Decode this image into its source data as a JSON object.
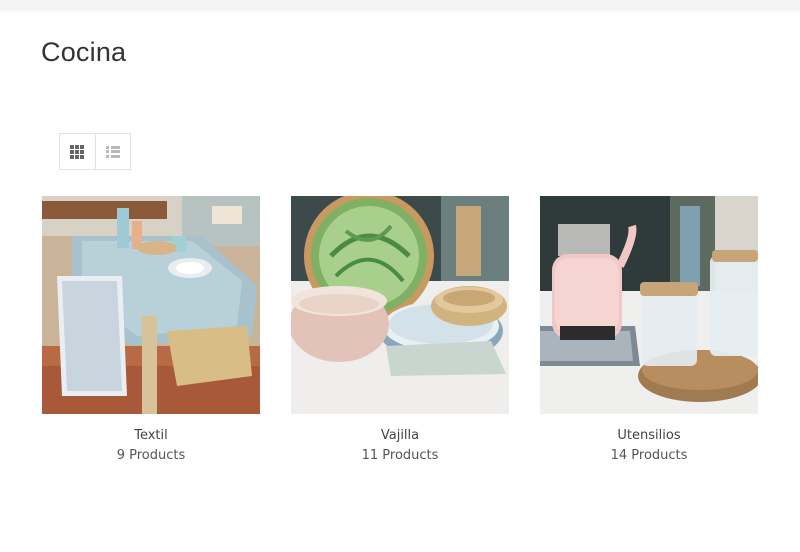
{
  "page": {
    "title": "Cocina"
  },
  "view_switcher": {
    "grid_icon": "grid-icon",
    "list_icon": "list-icon",
    "active": "grid"
  },
  "categories": [
    {
      "name": "Textil",
      "count": "9 Products"
    },
    {
      "name": "Vajilla",
      "count": "11 Products"
    },
    {
      "name": "Utensilios",
      "count": "14 Products"
    }
  ]
}
